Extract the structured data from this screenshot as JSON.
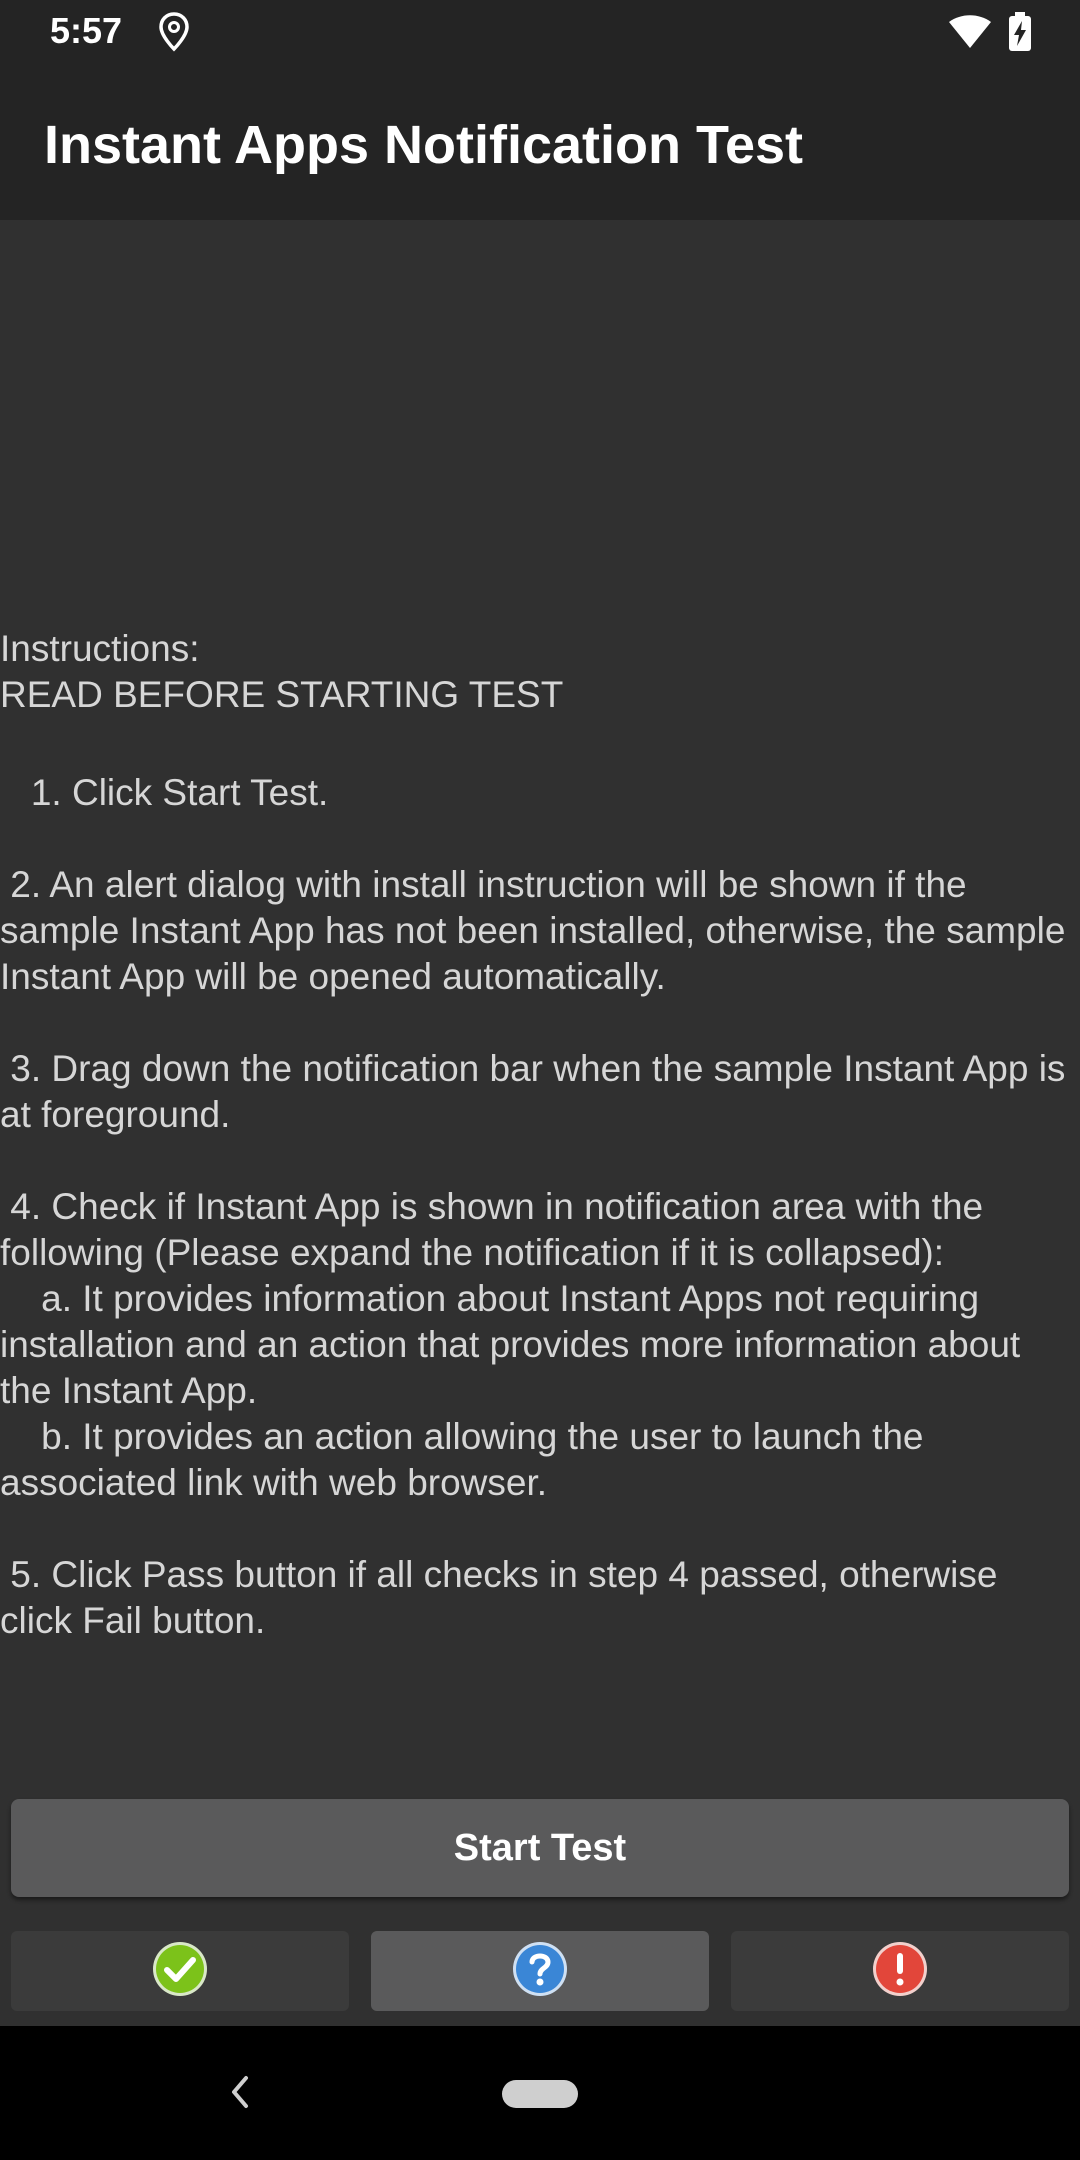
{
  "status_bar": {
    "time": "5:57",
    "icons": [
      "location-icon",
      "wifi-icon",
      "battery-charging-icon"
    ]
  },
  "app_bar": {
    "title": "Instant Apps Notification Test"
  },
  "instructions": {
    "heading": "Instructions:\nREAD BEFORE STARTING TEST",
    "body": " 1. Click Start Test.\n\n 2. An alert dialog with install instruction will be shown if the sample Instant App has not been installed, otherwise, the sample Instant App will be opened automatically.\n\n 3. Drag down the notification bar when the sample Instant App is at foreground.\n\n 4. Check if Instant App is shown in notification area with the following (Please expand the notification if it is collapsed):\n    a. It provides information about Instant Apps not requiring installation and an action that provides more information about the Instant App.\n    b. It provides an action allowing the user to launch the associated link with web browser.\n\n 5. Click Pass button if all checks in step 4 passed, otherwise click Fail button."
  },
  "buttons": {
    "start_test": "Start Test",
    "pass_icon": "check-circle-icon",
    "info_icon": "question-circle-icon",
    "fail_icon": "exclamation-circle-icon"
  },
  "colors": {
    "background": "#303030",
    "bar": "#242424",
    "button": "#5a5a5b",
    "pass": "#7cc21a",
    "info": "#3a86d6",
    "fail": "#e2463a"
  },
  "nav_bar": {
    "icons": [
      "back-icon",
      "home-pill-icon"
    ]
  }
}
